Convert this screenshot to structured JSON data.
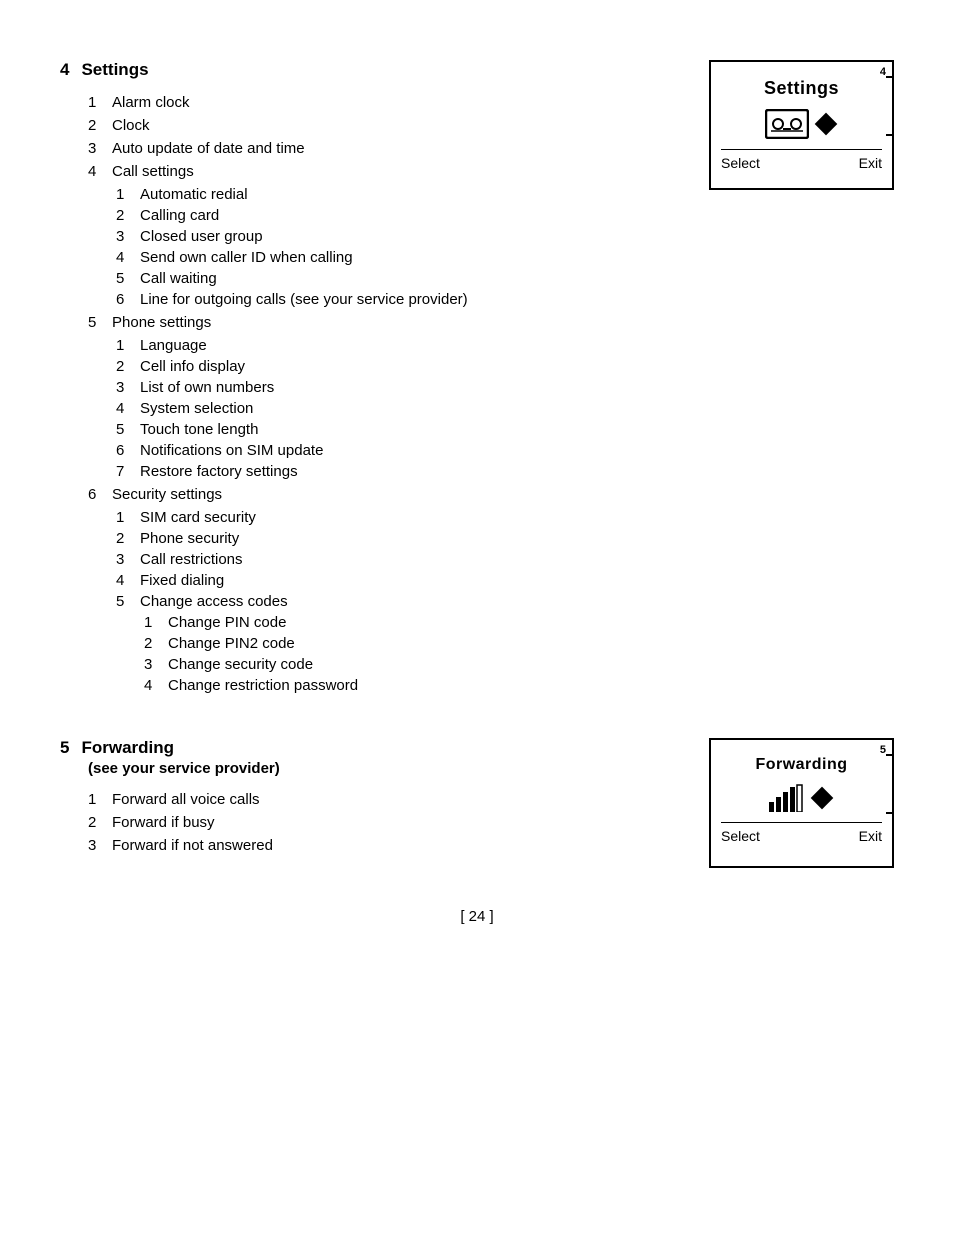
{
  "page": {
    "footer": "[ 24 ]"
  },
  "section4": {
    "number": "4",
    "title": "Settings",
    "mockup": {
      "corner_number": "4",
      "title": "Settings",
      "select_label": "Select",
      "exit_label": "Exit"
    },
    "items": [
      {
        "num": "1",
        "text": "Alarm clock"
      },
      {
        "num": "2",
        "text": "Clock"
      },
      {
        "num": "3",
        "text": "Auto update of date and time"
      },
      {
        "num": "4",
        "text": "Call settings",
        "subitems": [
          {
            "num": "1",
            "text": "Automatic redial"
          },
          {
            "num": "2",
            "text": "Calling card"
          },
          {
            "num": "3",
            "text": "Closed user group"
          },
          {
            "num": "4",
            "text": "Send own caller ID when calling"
          },
          {
            "num": "5",
            "text": "Call waiting"
          },
          {
            "num": "6",
            "text": "Line for outgoing calls (see your service provider)"
          }
        ]
      },
      {
        "num": "5",
        "text": "Phone settings",
        "subitems": [
          {
            "num": "1",
            "text": "Language"
          },
          {
            "num": "2",
            "text": "Cell info display"
          },
          {
            "num": "3",
            "text": "List of own numbers"
          },
          {
            "num": "4",
            "text": "System selection"
          },
          {
            "num": "5",
            "text": "Touch tone length"
          },
          {
            "num": "6",
            "text": "Notifications on SIM update"
          },
          {
            "num": "7",
            "text": "Restore factory settings"
          }
        ]
      },
      {
        "num": "6",
        "text": "Security settings",
        "subitems": [
          {
            "num": "1",
            "text": "SIM card security"
          },
          {
            "num": "2",
            "text": "Phone security"
          },
          {
            "num": "3",
            "text": "Call restrictions"
          },
          {
            "num": "4",
            "text": "Fixed dialing"
          },
          {
            "num": "5",
            "text": "Change access codes",
            "subsubitems": [
              {
                "num": "1",
                "text": "Change PIN code"
              },
              {
                "num": "2",
                "text": "Change PIN2 code"
              },
              {
                "num": "3",
                "text": "Change security code"
              },
              {
                "num": "4",
                "text": "Change restriction password"
              }
            ]
          }
        ]
      }
    ]
  },
  "section5": {
    "number": "5",
    "title": "Forwarding",
    "subtitle": "(see your service provider)",
    "mockup": {
      "corner_number": "5",
      "title": "Forwarding",
      "select_label": "Select",
      "exit_label": "Exit"
    },
    "items": [
      {
        "num": "1",
        "text": "Forward all voice calls"
      },
      {
        "num": "2",
        "text": "Forward if busy"
      },
      {
        "num": "3",
        "text": "Forward if not answered"
      }
    ]
  }
}
